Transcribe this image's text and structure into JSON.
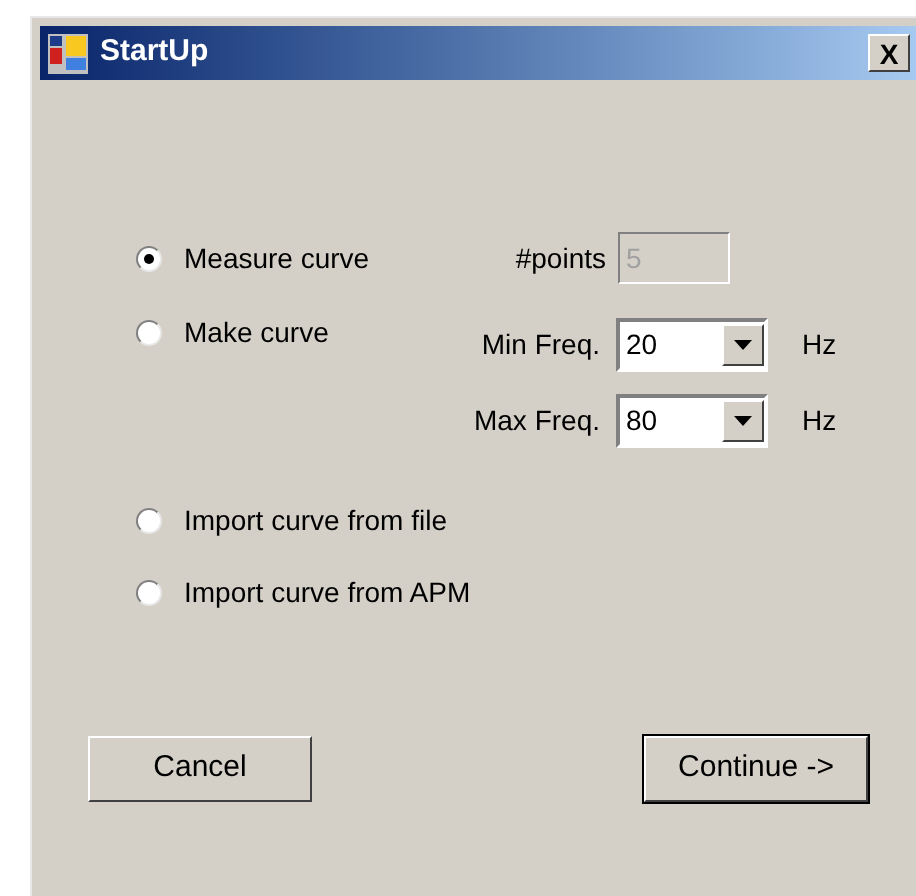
{
  "window": {
    "title": "StartUp",
    "close": "X"
  },
  "modes": [
    {
      "label": "Measure curve",
      "selected": true
    },
    {
      "label": "Make curve",
      "selected": false
    }
  ],
  "points": {
    "label": "#points",
    "value": "5",
    "disabled": true
  },
  "freqs": [
    {
      "label": "Min Freq.",
      "value": "20",
      "unit": "Hz"
    },
    {
      "label": "Max Freq.",
      "value": "80",
      "unit": "Hz"
    }
  ],
  "imports": [
    {
      "label": "Import curve from file",
      "selected": false
    },
    {
      "label": "Import curve from APM",
      "selected": false
    }
  ],
  "buttons": [
    {
      "label": "Cancel",
      "default": false
    },
    {
      "label": "Continue ->",
      "default": true
    }
  ]
}
